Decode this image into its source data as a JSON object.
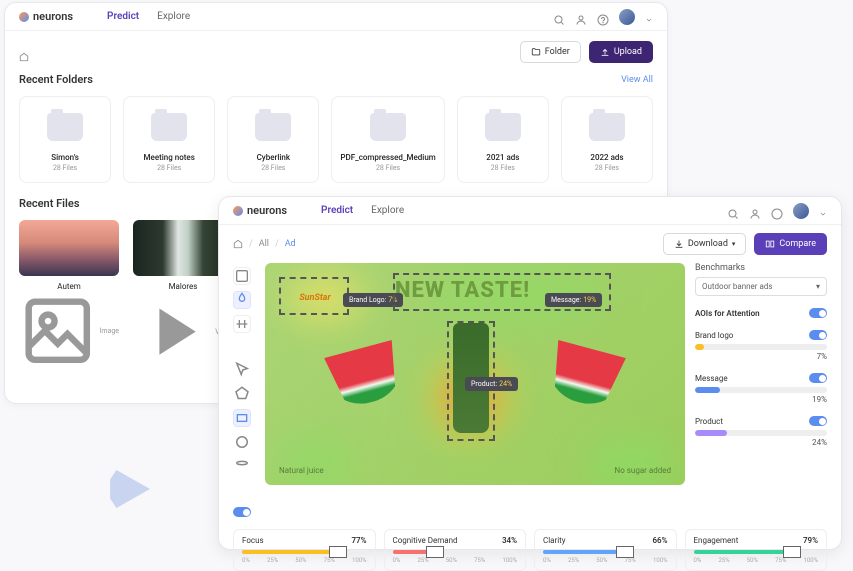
{
  "app": {
    "name": "neurons"
  },
  "nav": {
    "predict": "Predict",
    "explore": "Explore"
  },
  "win1": {
    "actions": {
      "folder": "Folder",
      "upload": "Upload"
    },
    "recentFolders": {
      "title": "Recent Folders",
      "viewAll": "View All"
    },
    "folders": [
      {
        "name": "Simon's",
        "meta": "28 Files"
      },
      {
        "name": "Meeting notes",
        "meta": "28 Files"
      },
      {
        "name": "Cyberlink",
        "meta": "28 Files"
      },
      {
        "name": "PDF_compressed_Medium",
        "meta": "28 Files"
      },
      {
        "name": "2021 ads",
        "meta": "28 Files"
      },
      {
        "name": "2022 ads",
        "meta": "28 Files"
      }
    ],
    "recentFiles": {
      "title": "Recent Files"
    },
    "files": [
      {
        "name": "Autem",
        "type": "Image"
      },
      {
        "name": "Malores",
        "type": "Video"
      }
    ]
  },
  "win2": {
    "breadcrumb": {
      "all": "All",
      "current": "Ad"
    },
    "actions": {
      "download": "Download",
      "compare": "Compare"
    },
    "benchmarks": {
      "label": "Benchmarks",
      "selected": "Outdoor banner ads"
    },
    "aois": {
      "title": "AOIs for Attention",
      "items": [
        {
          "name": "Brand logo",
          "pct": "7%",
          "color": "#fbbf24"
        },
        {
          "name": "Message",
          "pct": "19%",
          "color": "#5b8def"
        },
        {
          "name": "Product",
          "pct": "24%",
          "color": "#a78bfa"
        }
      ]
    },
    "overlay": {
      "brandLogo": {
        "label": "Brand Logo:",
        "pct": "7%"
      },
      "message": {
        "label": "Message:",
        "pct": "19%"
      },
      "product": {
        "label": "Product:",
        "pct": "24%"
      },
      "headline": "NEW TASTE!",
      "leftText": "Natural juice",
      "rightText": "No sugar added",
      "logoText": "SunStar"
    },
    "metrics": [
      {
        "name": "Focus",
        "value": "77%",
        "color": "#fbbf24",
        "pos": 77
      },
      {
        "name": "Cognitive Demand",
        "value": "34%",
        "color": "#f87171",
        "pos": 34
      },
      {
        "name": "Clarity",
        "value": "66%",
        "color": "#60a5fa",
        "pos": 66
      },
      {
        "name": "Engagement",
        "value": "79%",
        "color": "#34d399",
        "pos": 79
      }
    ],
    "ticks": [
      "0%",
      "25%",
      "50%",
      "75%",
      "100%"
    ]
  }
}
